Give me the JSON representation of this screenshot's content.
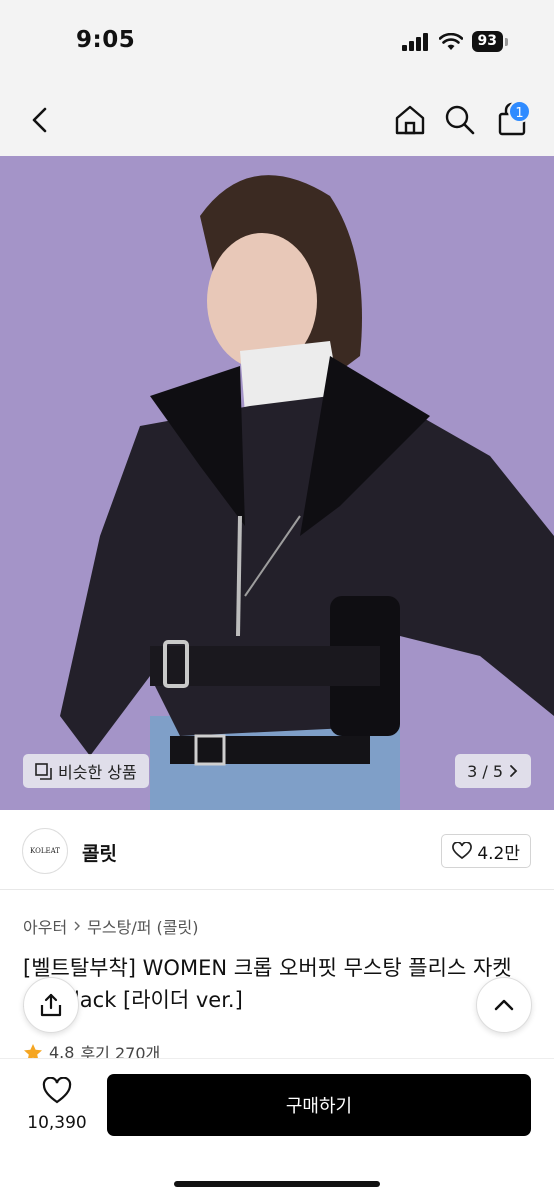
{
  "status": {
    "time": "9:05",
    "battery": "93"
  },
  "nav": {
    "cart_badge": "1"
  },
  "hero": {
    "similar_label": "비슷한 상품",
    "page_indicator": "3 / 5"
  },
  "brand": {
    "logo_text": "KOLEAT",
    "name": "콜릿",
    "like_count": "4.2만"
  },
  "breadcrumb": {
    "level1": "아우터",
    "level2": "무스탕/퍼 (콜릿)"
  },
  "product": {
    "title": "[벨트탈부착] WOMEN 크롭 오버핏 무스탕 플리스 자켓 All_Black [라이더 ver.]",
    "rating": "4.8",
    "reviews": "후기 270개"
  },
  "bottom": {
    "wish_count": "10,390",
    "buy_label": "구매하기"
  },
  "colors": {
    "hero_bg": "#a494c8",
    "badge": "#2f8bff",
    "buy_bg": "#000000"
  }
}
